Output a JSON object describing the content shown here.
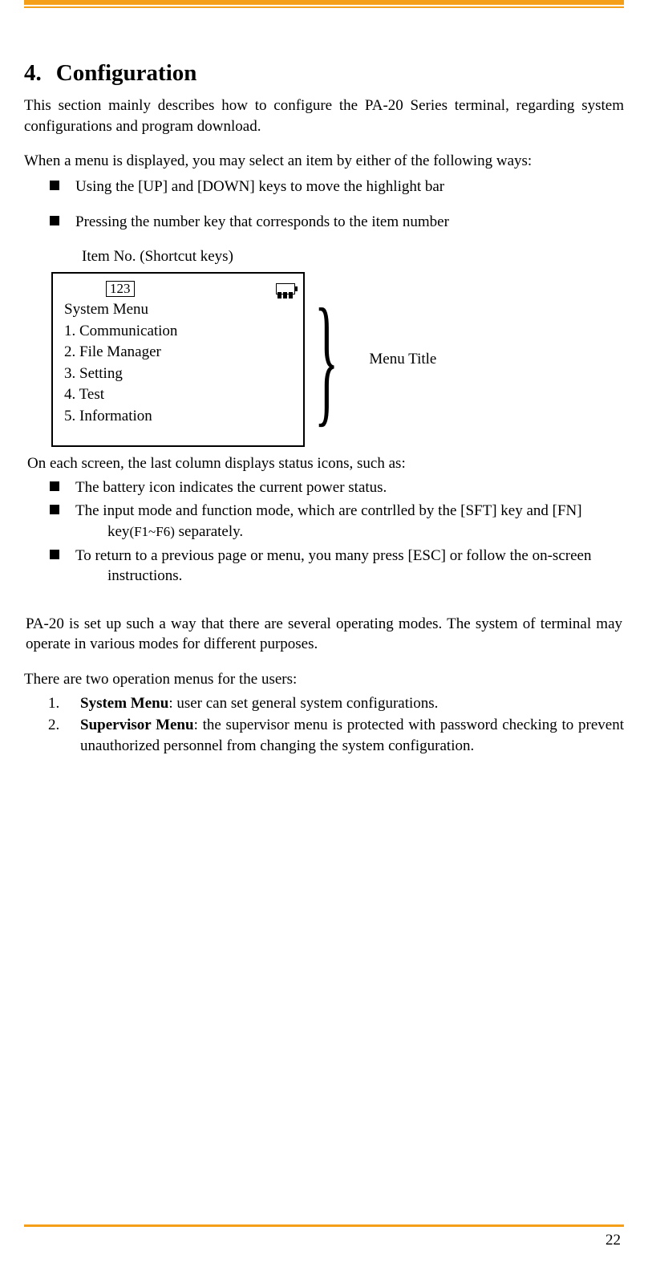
{
  "heading": {
    "number": "4.",
    "title": "Configuration"
  },
  "intro": "This section mainly describes how to configure the PA-20 Series terminal, regarding system configurations and program download.",
  "menuSelect": {
    "lead": "When a menu is displayed, you may select an item by either of the following ways:",
    "items": [
      "Using the [UP] and [DOWN] keys to move the highlight bar",
      "Pressing the number key that corresponds to the item number"
    ],
    "shortcutLabel": "Item No. (Shortcut keys)"
  },
  "screen": {
    "inputMode": "123",
    "menuTitle": "System Menu",
    "items": [
      "1. Communication",
      "2. File Manager",
      "3. Setting",
      "4. Test",
      "5. Information"
    ],
    "annotation": "Menu Title"
  },
  "afterScreen": "On each screen, the last column displays status icons, such as:",
  "statusBullets": [
    {
      "main": "The battery icon indicates the current power status."
    },
    {
      "main": "The input mode and function mode, which are contrlled by the [SFT] key and [FN]",
      "sub": "key(F1~F6) separately.",
      "subSmall": "(F1~F6)"
    },
    {
      "main": "To return to a previous page or menu, you many press [ESC] or follow the on-screen",
      "sub": "instructions."
    }
  ],
  "modesPara": "PA-20 is set up such a way that there are several operating modes. The system of terminal may operate in various modes for different purposes.",
  "opsIntro": "There are two operation menus for the users:",
  "ops": [
    {
      "n": "1.",
      "bold": "System Menu",
      "rest": ": user can set general system configurations."
    },
    {
      "n": "2.",
      "bold": "Supervisor Menu",
      "rest": ": the supervisor menu is protected with password checking to prevent unauthorized personnel from changing the system configuration."
    }
  ],
  "pageNumber": "22"
}
